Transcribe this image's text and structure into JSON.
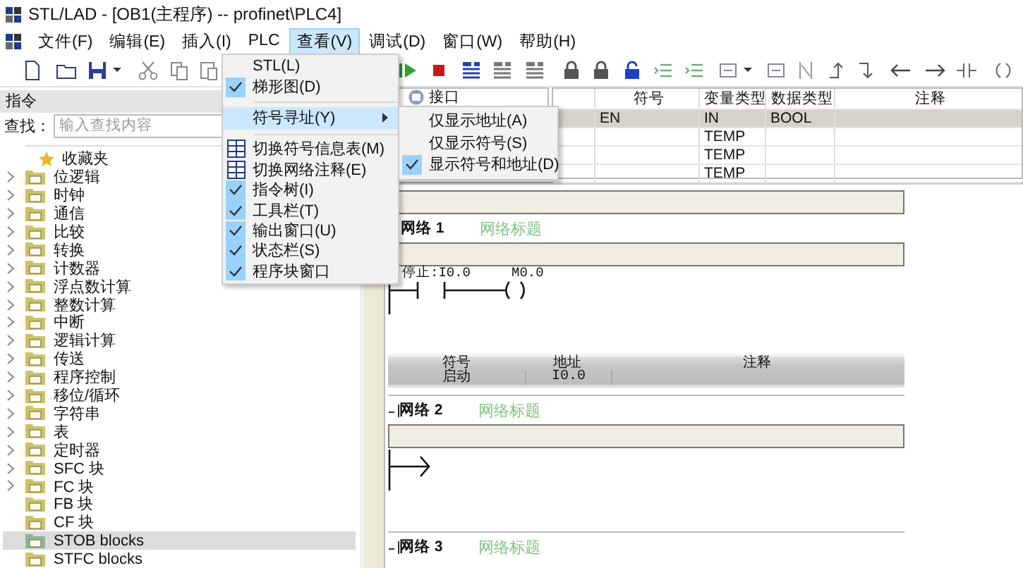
{
  "window": {
    "title": "STL/LAD - [OB1(主程序) -- profinet\\PLC4]"
  },
  "menu_bar": [
    {
      "label": "文件(F)",
      "selected": false
    },
    {
      "label": "编辑(E)",
      "selected": false
    },
    {
      "label": "插入(I)",
      "selected": false
    },
    {
      "label": "PLC",
      "selected": false
    },
    {
      "label": "查看(V)",
      "selected": true
    },
    {
      "label": "调试(D)",
      "selected": false
    },
    {
      "label": "窗口(W)",
      "selected": false
    },
    {
      "label": "帮助(H)",
      "selected": false
    }
  ],
  "view_menu": {
    "items": [
      {
        "kind": "check",
        "label": "STL(L)",
        "checked": false,
        "selected": false
      },
      {
        "kind": "check",
        "label": "梯形图(D)",
        "checked": true,
        "selected": false
      },
      {
        "kind": "separator"
      },
      {
        "kind": "submenu",
        "label": "符号寻址(Y)",
        "selected": true
      },
      {
        "kind": "separator"
      },
      {
        "kind": "icon",
        "label": "切换符号信息表(M)",
        "selected": false
      },
      {
        "kind": "icon",
        "label": "切换网络注释(E)",
        "selected": false
      },
      {
        "kind": "check",
        "label": "指令树(I)",
        "checked": true,
        "selected": false
      },
      {
        "kind": "check",
        "label": "工具栏(T)",
        "checked": true,
        "selected": false
      },
      {
        "kind": "check",
        "label": "输出窗口(U)",
        "checked": true,
        "selected": false
      },
      {
        "kind": "check",
        "label": "状态栏(S)",
        "checked": true,
        "selected": false
      },
      {
        "kind": "check",
        "label": "程序块窗口",
        "checked": true,
        "selected": false
      }
    ]
  },
  "symbol_submenu": {
    "items": [
      {
        "label": "仅显示地址(A)",
        "checked": false,
        "selected": false
      },
      {
        "label": "仅显示符号(S)",
        "checked": false,
        "selected": false
      },
      {
        "label": "显示符号和地址(D)",
        "checked": true,
        "selected": false
      }
    ]
  },
  "instructions_panel": {
    "title": "指令",
    "search": {
      "label": "查找：",
      "placeholder": "输入查找内容"
    },
    "tree": [
      {
        "kind": "star",
        "label": "收藏夹",
        "expandable": false,
        "selected": false
      },
      {
        "kind": "folder",
        "label": "位逻辑",
        "expandable": true,
        "selected": false
      },
      {
        "kind": "folder",
        "label": "时钟",
        "expandable": true,
        "selected": false
      },
      {
        "kind": "folder",
        "label": "通信",
        "expandable": true,
        "selected": false
      },
      {
        "kind": "folder",
        "label": "比较",
        "expandable": true,
        "selected": false
      },
      {
        "kind": "folder",
        "label": "转换",
        "expandable": true,
        "selected": false
      },
      {
        "kind": "folder",
        "label": "计数器",
        "expandable": true,
        "selected": false
      },
      {
        "kind": "folder",
        "label": "浮点数计算",
        "expandable": true,
        "selected": false
      },
      {
        "kind": "folder",
        "label": "整数计算",
        "expandable": true,
        "selected": false
      },
      {
        "kind": "folder",
        "label": "中断",
        "expandable": true,
        "selected": false
      },
      {
        "kind": "folder",
        "label": "逻辑计算",
        "expandable": true,
        "selected": false
      },
      {
        "kind": "folder",
        "label": "传送",
        "expandable": true,
        "selected": false
      },
      {
        "kind": "folder",
        "label": "程序控制",
        "expandable": true,
        "selected": false
      },
      {
        "kind": "folder",
        "label": "移位/循环",
        "expandable": true,
        "selected": false
      },
      {
        "kind": "folder",
        "label": "字符串",
        "expandable": true,
        "selected": false
      },
      {
        "kind": "folder",
        "label": "表",
        "expandable": true,
        "selected": false
      },
      {
        "kind": "folder",
        "label": "定时器",
        "expandable": true,
        "selected": false
      },
      {
        "kind": "folder",
        "label": "SFC 块",
        "expandable": true,
        "selected": false
      },
      {
        "kind": "folder",
        "label": "FC 块",
        "expandable": true,
        "selected": false
      },
      {
        "kind": "folder",
        "label": "FB 块",
        "expandable": false,
        "selected": false
      },
      {
        "kind": "folder",
        "label": "CF 块",
        "expandable": false,
        "selected": false
      },
      {
        "kind": "folder",
        "label": "STOB blocks",
        "expandable": false,
        "selected": true
      },
      {
        "kind": "folder",
        "label": "STFC blocks",
        "expandable": false,
        "selected": false
      }
    ]
  },
  "interface": {
    "tree_label": "接口",
    "columns": [
      "符号",
      "变量类型",
      "数据类型",
      "注释"
    ],
    "rows": [
      {
        "symbol": "EN",
        "var_type": "IN",
        "data_type": "BOOL",
        "selected": true
      },
      {
        "var_type": "TEMP",
        "selected": false
      },
      {
        "var_type": "TEMP",
        "selected": false
      },
      {
        "var_type": "TEMP",
        "selected": false
      }
    ]
  },
  "networks": [
    {
      "label": "网络 1",
      "title": "网络标题",
      "collapse_icon": false,
      "rung": {
        "kind": "contact_coil",
        "contact": "停止:I0.0",
        "coil": "M0.0"
      },
      "symbol_table": {
        "columns": [
          "符号",
          "地址",
          "注释"
        ],
        "rows": [
          {
            "symbol": "启动",
            "address": "I0.0"
          }
        ]
      }
    },
    {
      "label": "网络 2",
      "title": "网络标题",
      "collapse_icon": true,
      "rung": {
        "kind": "empty"
      }
    },
    {
      "label": "网络 3",
      "title": "网络标题",
      "collapse_icon": true
    }
  ]
}
